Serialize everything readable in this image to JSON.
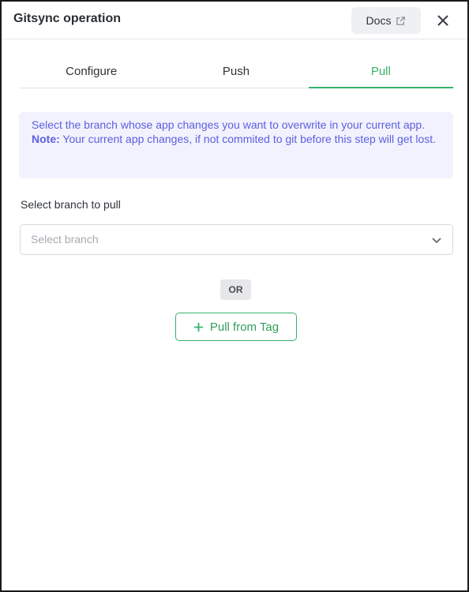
{
  "header": {
    "title": "Gitsync operation",
    "docs_label": "Docs"
  },
  "tabs": [
    {
      "label": "Configure",
      "active": false
    },
    {
      "label": "Push",
      "active": false
    },
    {
      "label": "Pull",
      "active": true
    }
  ],
  "info": {
    "text": "Select the branch whose app changes you want to overwrite in your current app.",
    "note_label": "Note:",
    "note_text": " Your current app changes, if not commited to git before this step will get lost."
  },
  "branch": {
    "label": "Select branch to pull",
    "placeholder": "Select branch"
  },
  "divider_text": "OR",
  "pull_tag_label": "Pull from Tag",
  "colors": {
    "accent": "#37b26c",
    "info_text": "#5d5fe0",
    "info_bg": "#f1f2fd"
  },
  "icons": [
    "external-link-icon",
    "close-icon",
    "chevron-down-icon",
    "plus-icon"
  ]
}
